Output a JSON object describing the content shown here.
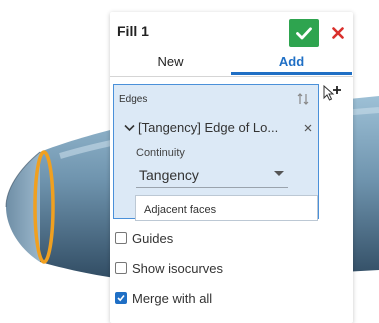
{
  "dialog": {
    "title": "Fill 1",
    "tabs": [
      "New",
      "Add"
    ],
    "edges": {
      "label": "Edges",
      "item": "[Tangency] Edge of Lo...",
      "continuity_label": "Continuity",
      "continuity_value": "Tangency",
      "adjacent_faces": "Adjacent faces"
    },
    "options": {
      "guides": "Guides",
      "show_isocurves": "Show isocurves",
      "merge_with_all": "Merge with all"
    },
    "checked": {
      "guides": false,
      "show_isocurves": false,
      "merge_with_all": true
    }
  },
  "colors": {
    "accent": "#1f6fc5",
    "ok": "#2ea44f",
    "cancel": "#d9302c",
    "edge_highlight": "#f0a020",
    "shape": "#8fb0c8"
  },
  "icons": [
    "check-icon",
    "close-icon",
    "sort-icon",
    "chevron-down-icon",
    "add-selection-icon"
  ]
}
